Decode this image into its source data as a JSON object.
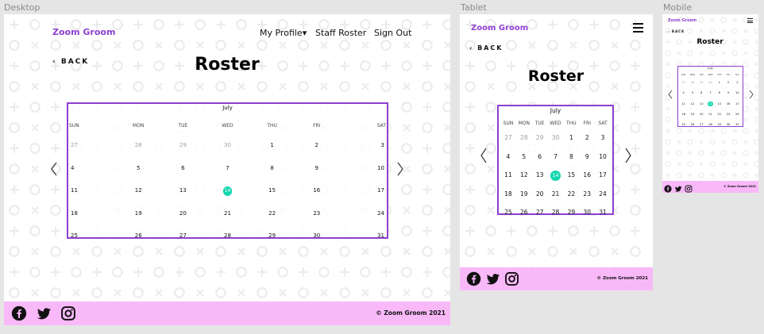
{
  "frames": {
    "desktop": {
      "label": "Desktop"
    },
    "tablet": {
      "label": "Tablet"
    },
    "mobile": {
      "label": "Mobile"
    }
  },
  "brand": "Zoom Groom",
  "nav": {
    "profile": "My Profile▾",
    "roster": "Staff Roster",
    "signout": "Sign Out"
  },
  "back_label": "‹ BACK",
  "page_title": "Roster",
  "calendar": {
    "month": "July",
    "dow_long": [
      "SUN",
      "MON",
      "TUE",
      "WED",
      "THU",
      "FRI",
      "SAT"
    ],
    "dow_short": [
      "SUN",
      "MON",
      "TUE",
      "WED",
      "THU",
      "FRI",
      "SAT"
    ],
    "weeks": [
      [
        "27",
        "28",
        "29",
        "30",
        "1",
        "2",
        "3"
      ],
      [
        "4",
        "5",
        "6",
        "7",
        "8",
        "9",
        "10"
      ],
      [
        "11",
        "12",
        "13",
        "14",
        "15",
        "16",
        "17"
      ],
      [
        "18",
        "19",
        "20",
        "21",
        "22",
        "23",
        "24"
      ],
      [
        "25",
        "26",
        "27",
        "28",
        "29",
        "30",
        "31"
      ]
    ],
    "muted_days_first_row": 4,
    "highlighted_day": "14"
  },
  "footer": {
    "copyright": "© Zoom Groom 2021",
    "social_icons": [
      "facebook-icon",
      "twitter-icon",
      "instagram-icon"
    ]
  },
  "colors": {
    "brand": "#8e3fd0",
    "footer_bg": "#f9b9f9",
    "today": "#14d6ae",
    "frame_bg": "#e5e5e5"
  }
}
